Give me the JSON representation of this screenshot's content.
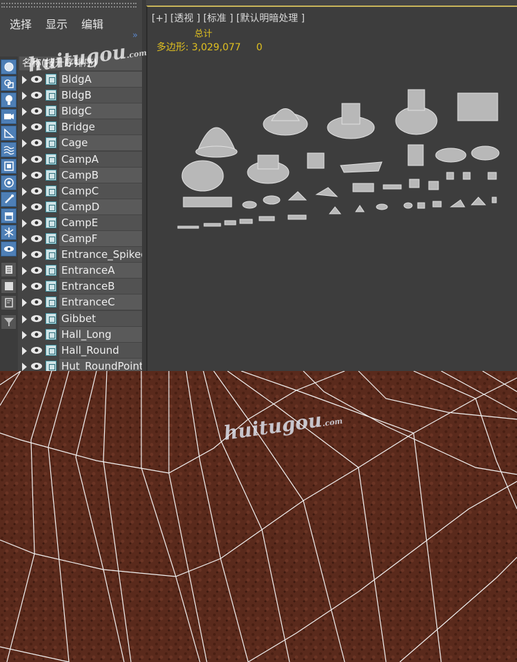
{
  "menu": {
    "items": [
      "选择",
      "显示",
      "编辑"
    ]
  },
  "scene_explorer": {
    "column_header": "名称(按升序排序)",
    "rows": [
      "BldgA",
      "BldgB",
      "BldgC",
      "Bridge",
      "Cage",
      "CampA",
      "CampB",
      "CampC",
      "CampD",
      "CampE",
      "CampF",
      "Entrance_Spiked",
      "EntranceA",
      "EntranceB",
      "EntranceC",
      "Gibbet",
      "Hall_Long",
      "Hall_Round",
      "Hut_RoundPoint"
    ]
  },
  "viewport": {
    "label": "[+] [透视 ] [标准 ] [默认明暗处理 ]",
    "stats_title": "总计",
    "polygons_label": "多边形:",
    "polygons_value": "3,029,077",
    "polygons_selected": "0"
  },
  "watermark": {
    "text": "huitugou",
    "sub": ".com"
  },
  "colors": {
    "accent": "#e0c020",
    "panel": "#444444",
    "tool_blue": "#4e7fb6",
    "terrain": "#5a2a1c"
  },
  "toolbar_icons": [
    "sphere-icon",
    "geometry-icon",
    "light-icon",
    "camera-icon",
    "helper-icon",
    "spacewarp-icon",
    "group-icon",
    "xref-icon",
    "bone-icon",
    "container-icon",
    "frozen-icon",
    "visibility-icon",
    "layer-icon",
    "selection-set-icon",
    "display-icon",
    "filter-icon"
  ]
}
